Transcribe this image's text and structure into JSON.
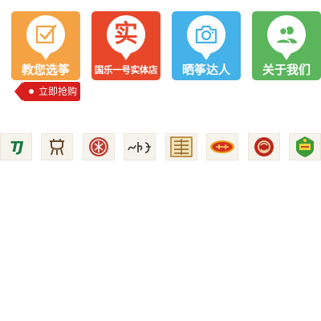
{
  "tiles": [
    {
      "label": "教您选筝",
      "icon": "checklist-icon",
      "color": "#f5a244"
    },
    {
      "label": "国乐一号实体店",
      "icon": "store-seal-icon",
      "glyph": "实",
      "color": "#e8472a"
    },
    {
      "label": "晒筝达人",
      "icon": "camera-icon",
      "color": "#44b1e8"
    },
    {
      "label": "关于我们",
      "icon": "users-icon",
      "color": "#5ab55c"
    }
  ],
  "buy_tag": {
    "label": "立即抢购",
    "color": "#d81e1e"
  },
  "brands": [
    {
      "icon": "tj-brand-logo",
      "text": "TJ"
    },
    {
      "icon": "bronze-vessel-brand-logo"
    },
    {
      "icon": "red-seal-brand-logo"
    },
    {
      "icon": "calligraphy-brand-logo"
    },
    {
      "icon": "golden-scroll-brand-logo"
    },
    {
      "icon": "red-oval-brand-logo"
    },
    {
      "icon": "red-round-seal-brand-logo"
    },
    {
      "icon": "green-crest-brand-logo"
    }
  ]
}
